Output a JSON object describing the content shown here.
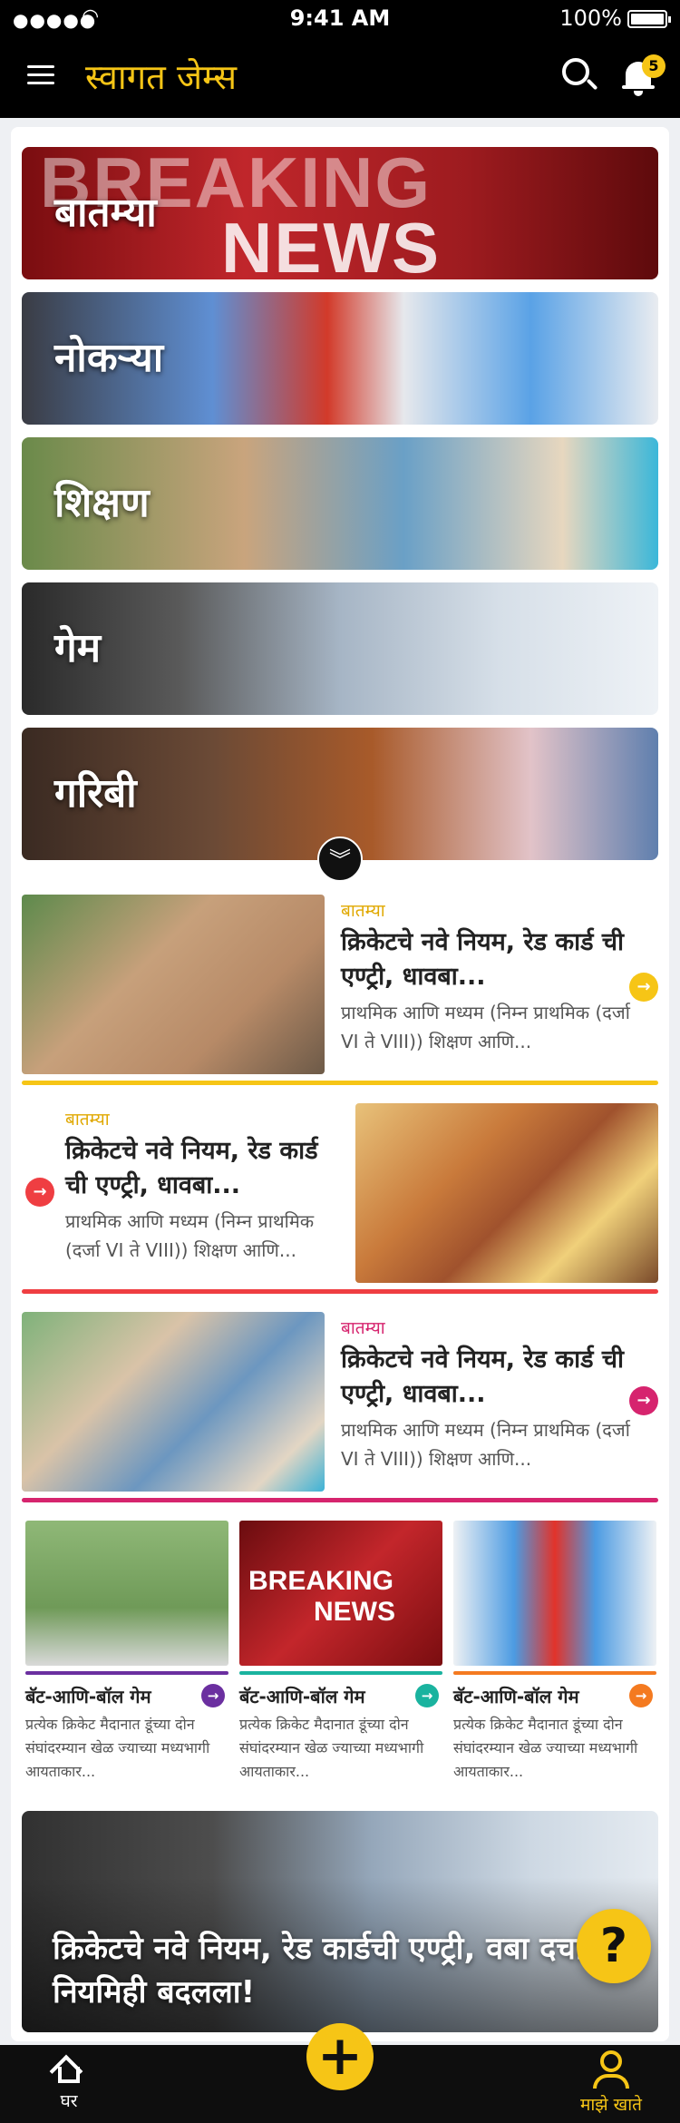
{
  "status": {
    "signal": "●●●●●",
    "wifi_icon": "wifi-icon",
    "time": "9:41 AM",
    "battery": "100%"
  },
  "header": {
    "title": "स्वागत जेम्स",
    "notification_count": "5",
    "accent": "#f6c516"
  },
  "categories": [
    {
      "label": "बातम्या",
      "overlay_text": [
        "BREAKING",
        "NEWS"
      ]
    },
    {
      "label": "नोकऱ्या"
    },
    {
      "label": "शिक्षण"
    },
    {
      "label": "गेम"
    },
    {
      "label": "गरिबी"
    }
  ],
  "expand_icon": "double-chevron-down-icon",
  "cards": [
    {
      "category": "बातम्या",
      "headline": "क्रिकेटचे नवे नियम, रेड कार्ड ची एण्ट्री, धावबा...",
      "desc": "प्राथमिक आणि मध्यम (निम्न प्राथमिक (दर्जा VI ते VIII)) शिक्षण आणि...",
      "accent": "#f6c516"
    },
    {
      "category": "बातम्या",
      "headline": "क्रिकेटचे नवे नियम, रेड कार्ड ची एण्ट्री, धावबा...",
      "desc": "प्राथमिक आणि मध्यम (निम्न प्राथमिक (दर्जा VI ते VIII)) शिक्षण आणि...",
      "accent": "#ef3e42"
    },
    {
      "category": "बातम्या",
      "headline": "क्रिकेटचे नवे नियम, रेड कार्ड ची एण्ट्री, धावबा...",
      "desc": "प्राथमिक आणि मध्यम (निम्न प्राथमिक (दर्जा VI ते VIII)) शिक्षण आणि...",
      "accent": "#d6246e"
    }
  ],
  "minis": [
    {
      "title": "बॅट-आणि-बॉल गेम",
      "desc": "प्रत्येक क्रिकेट मैदानात डूंच्या दोन संघांदरम्यान खेळ ज्याच्या मध्यभागी आयताकार...",
      "accent": "#6b2fa0"
    },
    {
      "title": "बॅट-आणि-बॉल गेम",
      "desc": "प्रत्येक क्रिकेट मैदानात डूंच्या दोन संघांदरम्यान खेळ ज्याच्या मध्यभागी आयताकार...",
      "accent": "#1ab39f"
    },
    {
      "title": "बॅट-आणि-बॉल गेम",
      "desc": "प्रत्येक क्रिकेट मैदानात डूंच्या दोन संघांदरम्यान खेळ ज्याच्या मध्यभागी आयताकार...",
      "accent": "#f47a20"
    }
  ],
  "mini_overlay": [
    "BREAKING",
    "NEWS"
  ],
  "hero": {
    "headline": "क्रिकेटचे नवे नियम, रेड कार्डची एण्ट्री, वबा दचा नियमिही बदलला!"
  },
  "help_label": "?",
  "bottom_nav": {
    "home": "घर",
    "add": "+",
    "account": "माझे खाते"
  }
}
